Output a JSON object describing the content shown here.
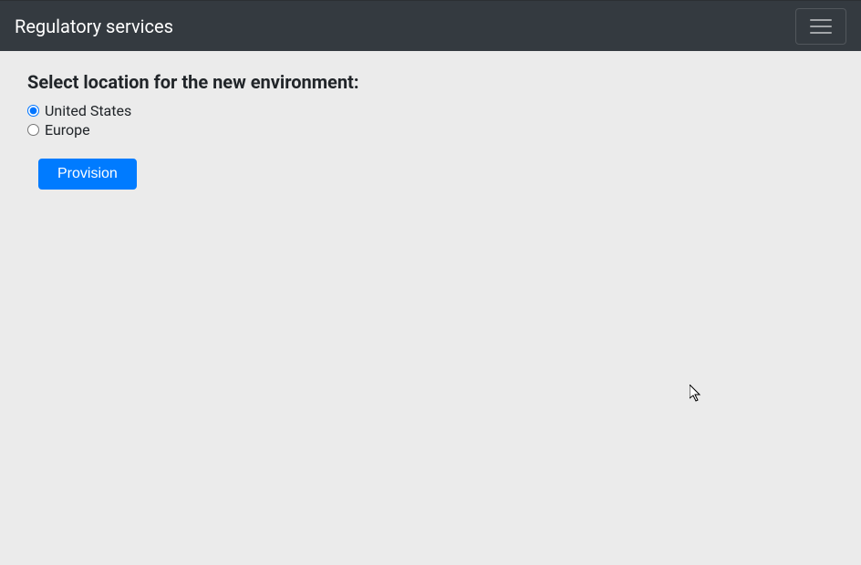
{
  "navbar": {
    "brand": "Regulatory services"
  },
  "form": {
    "heading": "Select location for the new environment:",
    "options": [
      {
        "label": "United States",
        "selected": true
      },
      {
        "label": "Europe",
        "selected": false
      }
    ],
    "submit_label": "Provision"
  }
}
